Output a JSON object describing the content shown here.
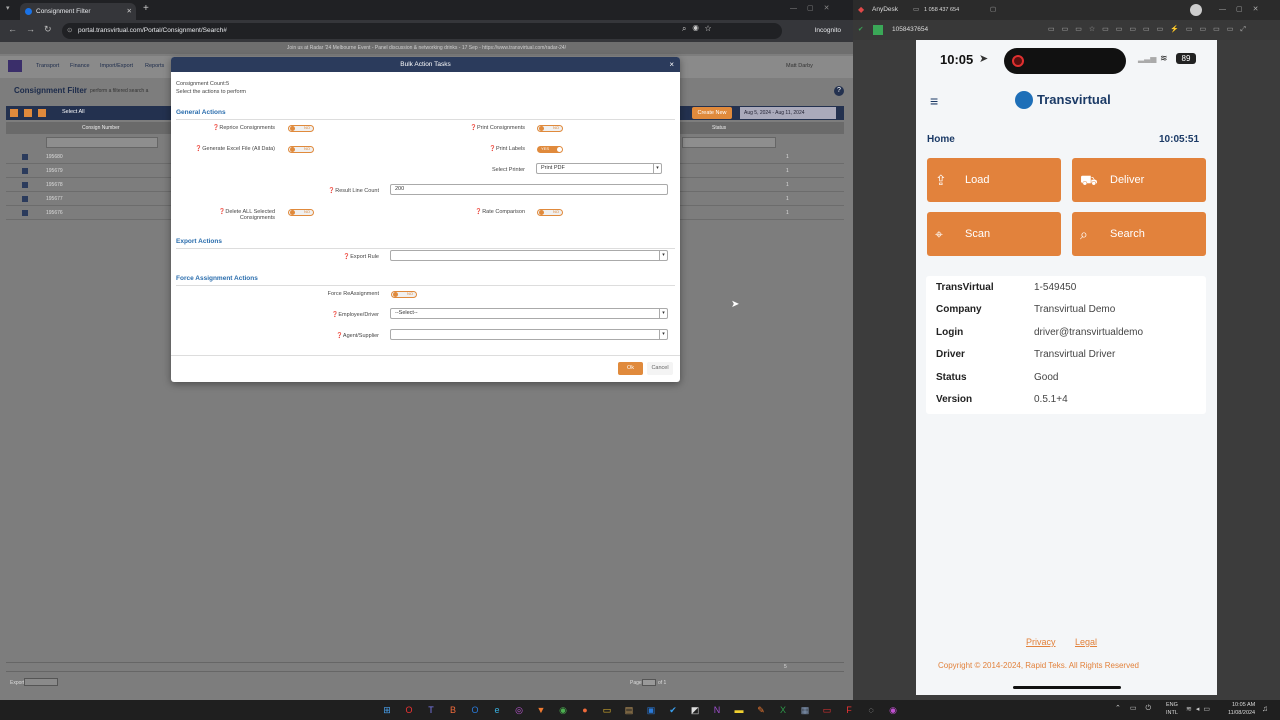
{
  "browser": {
    "tab_title": "Consignment Filter",
    "url": "portal.transvirtual.com/Portal/Consignment/Search#",
    "incognito_label": "Incognito",
    "banner": "Join us at Radar '24 Melbourne Event - Panel discussion & networking drinks - 17 Sep - https://www.transvirtual.com/radar-24/"
  },
  "portal": {
    "menu": [
      "Transport",
      "Finance",
      "Import/Export",
      "Reports"
    ],
    "user": "Matt Darby",
    "page_title": "Consignment Filter",
    "page_subtitle": "perform a filtered search a",
    "select_all": "Select All",
    "create_new": "Create New",
    "date_range": "Aug 5, 2024 - Aug 11, 2024",
    "col_consign_number": "Consign Number",
    "col_status": "Status",
    "rows": [
      "195680",
      "195679",
      "195678",
      "195677",
      "195676"
    ],
    "row_value": "1",
    "footer_number": "5",
    "export_label": "Export",
    "page_label": "Page",
    "of_label": "of 1"
  },
  "modal": {
    "title": "Bulk Action Tasks",
    "count": "Consignment Count:5",
    "instruction": "Select the actions to perform",
    "general_title": "General Actions",
    "reprice_label": "Reprice Consignments",
    "reprice_value": "NO",
    "print_consignments_label": "Print Consignments",
    "print_consignments_value": "NO",
    "excel_label": "Generate Excel File (All Data)",
    "excel_value": "NO",
    "print_labels_label": "Print Labels",
    "print_labels_value": "YES",
    "select_printer_label": "Select Printer",
    "select_printer_value": "Print PDF",
    "result_line_label": "Result Line Count",
    "result_line_value": "200",
    "delete_label": "Delete ALL Selected Consignments",
    "delete_value": "NO",
    "rate_label": "Rate Comparison",
    "rate_value": "NO",
    "export_title": "Export Actions",
    "export_rule_label": "Export Rule",
    "export_rule_value": "",
    "force_title": "Force Assignment Actions",
    "force_reassign_label": "Force ReAssignment",
    "force_reassign_value": "NO",
    "employee_label": "Employee/Driver",
    "employee_value": "--Select--",
    "agent_label": "Agent/Supplier",
    "agent_value": "",
    "ok_label": "Ok",
    "cancel_label": "Cancel"
  },
  "anydesk": {
    "app_name": "AnyDesk",
    "session_id": "1 058 437 654",
    "address": "1058437654"
  },
  "phone": {
    "time": "10:05",
    "battery": "89",
    "brand": "Transvirtual",
    "home_label": "Home",
    "clock": "10:05:51",
    "tiles": [
      "Load",
      "Deliver",
      "Scan",
      "Search"
    ],
    "info": [
      {
        "key": "TransVirtual",
        "value": "1-549450"
      },
      {
        "key": "Company",
        "value": "Transvirtual Demo"
      },
      {
        "key": "Login",
        "value": "driver@transvirtualdemo"
      },
      {
        "key": "Driver",
        "value": "Transvirtual Driver"
      },
      {
        "key": "Status",
        "value": "Good"
      },
      {
        "key": "Version",
        "value": "0.5.1+4"
      }
    ],
    "privacy": "Privacy",
    "legal": "Legal",
    "copyright": "Copyright © 2014-2024, Rapid Teks. All Rights Reserved"
  },
  "taskbar": {
    "lang1": "ENG",
    "lang2": "INTL",
    "time": "10:05 AM",
    "date": "11/08/2024"
  },
  "colors": {
    "accent": "#e08a3c",
    "header_navy": "#2b3b5c",
    "section_blue": "#2a6dad"
  }
}
